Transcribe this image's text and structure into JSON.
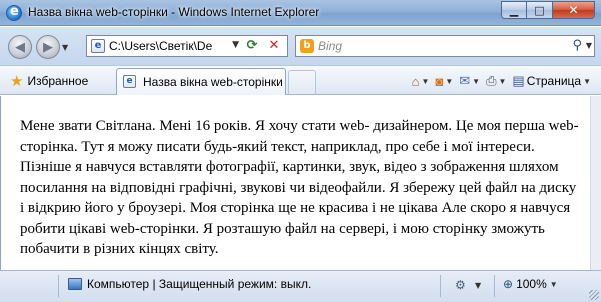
{
  "window": {
    "title": "Назва вікна web-сторінки - Windows Internet Explorer",
    "controls": {
      "minimize": "▁",
      "maximize": "□",
      "close": "✕"
    }
  },
  "nav": {
    "back": "◀",
    "forward": "▶",
    "address": "C:\\Users\\Светік\\De",
    "search_placeholder": "Bing"
  },
  "toolbar": {
    "favorites_label": "Избранное",
    "tab_label": "Назва вікна web-сторінки",
    "page_menu_label": "Страница"
  },
  "content": {
    "text": "Мене звати Світлана. Мені 16 років. Я хочу стати web- дизайнером. Це моя перша web-сторінка. Тут я можу писати будь-який текст, наприклад, про себе і мої інтереси. Пізніше я навчуся вставляти фотографії, картинки, звук, відео з зображення шляхом посилання на відповідні графічні, звукові чи відеофайли. Я збережу цей файл на диску і відкрию його у броузері. Моя сторінка ще не красива і не цікава Але скоро я навчуся робити цікаві web-сторінки. Я розташую файл на сервері, і мою сторінку зможуть побачити в різних кінцях світу."
  },
  "status": {
    "zone_text": "Компьютер | Защищенный режим: выкл.",
    "zoom": "100%"
  },
  "colors": {
    "titlebar": "#93b4da",
    "close_button": "#c23a1f",
    "toolbar_bg": "#dde7f4"
  }
}
